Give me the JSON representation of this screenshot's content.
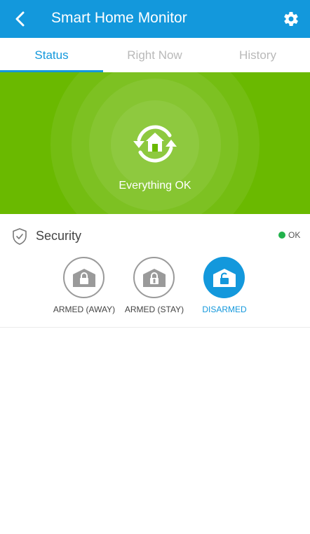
{
  "header": {
    "title": "Smart Home Monitor",
    "back_icon": "chevron-left-icon",
    "settings_icon": "gear-icon"
  },
  "tabs": [
    {
      "label": "Status",
      "active": true
    },
    {
      "label": "Right Now",
      "active": false
    },
    {
      "label": "History",
      "active": false
    }
  ],
  "hero": {
    "status_text": "Everything OK",
    "icon": "home-sync-icon",
    "color": "#6ab900"
  },
  "security": {
    "title": "Security",
    "icon": "shield-check-icon",
    "status_text": "OK",
    "status_color": "#22b24c",
    "modes": [
      {
        "label": "ARMED (AWAY)",
        "icon": "lock-closed-icon",
        "selected": false
      },
      {
        "label": "ARMED (STAY)",
        "icon": "lock-person-icon",
        "selected": false
      },
      {
        "label": "DISARMED",
        "icon": "lock-open-icon",
        "selected": true
      }
    ]
  },
  "colors": {
    "accent": "#1398dc",
    "ok_green": "#6ab900"
  }
}
